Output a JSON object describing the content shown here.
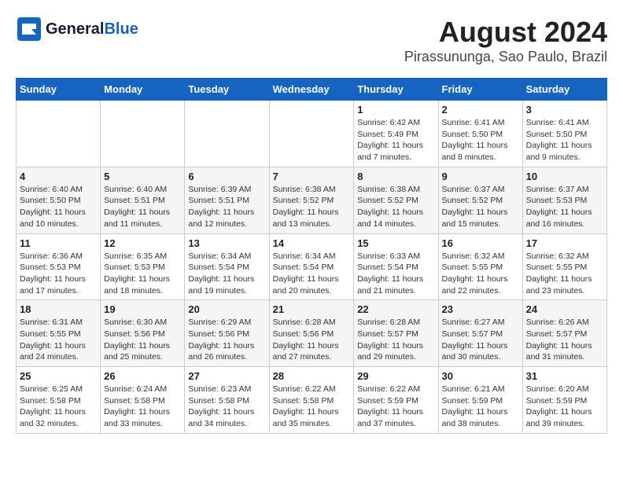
{
  "header": {
    "logo_general": "General",
    "logo_blue": "Blue",
    "title": "August 2024",
    "subtitle": "Pirassununga, Sao Paulo, Brazil"
  },
  "calendar": {
    "weekdays": [
      "Sunday",
      "Monday",
      "Tuesday",
      "Wednesday",
      "Thursday",
      "Friday",
      "Saturday"
    ],
    "weeks": [
      [
        {
          "day": "",
          "info": ""
        },
        {
          "day": "",
          "info": ""
        },
        {
          "day": "",
          "info": ""
        },
        {
          "day": "",
          "info": ""
        },
        {
          "day": "1",
          "info": "Sunrise: 6:42 AM\nSunset: 5:49 PM\nDaylight: 11 hours\nand 7 minutes."
        },
        {
          "day": "2",
          "info": "Sunrise: 6:41 AM\nSunset: 5:50 PM\nDaylight: 11 hours\nand 8 minutes."
        },
        {
          "day": "3",
          "info": "Sunrise: 6:41 AM\nSunset: 5:50 PM\nDaylight: 11 hours\nand 9 minutes."
        }
      ],
      [
        {
          "day": "4",
          "info": "Sunrise: 6:40 AM\nSunset: 5:50 PM\nDaylight: 11 hours\nand 10 minutes."
        },
        {
          "day": "5",
          "info": "Sunrise: 6:40 AM\nSunset: 5:51 PM\nDaylight: 11 hours\nand 11 minutes."
        },
        {
          "day": "6",
          "info": "Sunrise: 6:39 AM\nSunset: 5:51 PM\nDaylight: 11 hours\nand 12 minutes."
        },
        {
          "day": "7",
          "info": "Sunrise: 6:38 AM\nSunset: 5:52 PM\nDaylight: 11 hours\nand 13 minutes."
        },
        {
          "day": "8",
          "info": "Sunrise: 6:38 AM\nSunset: 5:52 PM\nDaylight: 11 hours\nand 14 minutes."
        },
        {
          "day": "9",
          "info": "Sunrise: 6:37 AM\nSunset: 5:52 PM\nDaylight: 11 hours\nand 15 minutes."
        },
        {
          "day": "10",
          "info": "Sunrise: 6:37 AM\nSunset: 5:53 PM\nDaylight: 11 hours\nand 16 minutes."
        }
      ],
      [
        {
          "day": "11",
          "info": "Sunrise: 6:36 AM\nSunset: 5:53 PM\nDaylight: 11 hours\nand 17 minutes."
        },
        {
          "day": "12",
          "info": "Sunrise: 6:35 AM\nSunset: 5:53 PM\nDaylight: 11 hours\nand 18 minutes."
        },
        {
          "day": "13",
          "info": "Sunrise: 6:34 AM\nSunset: 5:54 PM\nDaylight: 11 hours\nand 19 minutes."
        },
        {
          "day": "14",
          "info": "Sunrise: 6:34 AM\nSunset: 5:54 PM\nDaylight: 11 hours\nand 20 minutes."
        },
        {
          "day": "15",
          "info": "Sunrise: 6:33 AM\nSunset: 5:54 PM\nDaylight: 11 hours\nand 21 minutes."
        },
        {
          "day": "16",
          "info": "Sunrise: 6:32 AM\nSunset: 5:55 PM\nDaylight: 11 hours\nand 22 minutes."
        },
        {
          "day": "17",
          "info": "Sunrise: 6:32 AM\nSunset: 5:55 PM\nDaylight: 11 hours\nand 23 minutes."
        }
      ],
      [
        {
          "day": "18",
          "info": "Sunrise: 6:31 AM\nSunset: 5:55 PM\nDaylight: 11 hours\nand 24 minutes."
        },
        {
          "day": "19",
          "info": "Sunrise: 6:30 AM\nSunset: 5:56 PM\nDaylight: 11 hours\nand 25 minutes."
        },
        {
          "day": "20",
          "info": "Sunrise: 6:29 AM\nSunset: 5:56 PM\nDaylight: 11 hours\nand 26 minutes."
        },
        {
          "day": "21",
          "info": "Sunrise: 6:28 AM\nSunset: 5:56 PM\nDaylight: 11 hours\nand 27 minutes."
        },
        {
          "day": "22",
          "info": "Sunrise: 6:28 AM\nSunset: 5:57 PM\nDaylight: 11 hours\nand 29 minutes."
        },
        {
          "day": "23",
          "info": "Sunrise: 6:27 AM\nSunset: 5:57 PM\nDaylight: 11 hours\nand 30 minutes."
        },
        {
          "day": "24",
          "info": "Sunrise: 6:26 AM\nSunset: 5:57 PM\nDaylight: 11 hours\nand 31 minutes."
        }
      ],
      [
        {
          "day": "25",
          "info": "Sunrise: 6:25 AM\nSunset: 5:58 PM\nDaylight: 11 hours\nand 32 minutes."
        },
        {
          "day": "26",
          "info": "Sunrise: 6:24 AM\nSunset: 5:58 PM\nDaylight: 11 hours\nand 33 minutes."
        },
        {
          "day": "27",
          "info": "Sunrise: 6:23 AM\nSunset: 5:58 PM\nDaylight: 11 hours\nand 34 minutes."
        },
        {
          "day": "28",
          "info": "Sunrise: 6:22 AM\nSunset: 5:58 PM\nDaylight: 11 hours\nand 35 minutes."
        },
        {
          "day": "29",
          "info": "Sunrise: 6:22 AM\nSunset: 5:59 PM\nDaylight: 11 hours\nand 37 minutes."
        },
        {
          "day": "30",
          "info": "Sunrise: 6:21 AM\nSunset: 5:59 PM\nDaylight: 11 hours\nand 38 minutes."
        },
        {
          "day": "31",
          "info": "Sunrise: 6:20 AM\nSunset: 5:59 PM\nDaylight: 11 hours\nand 39 minutes."
        }
      ]
    ]
  }
}
